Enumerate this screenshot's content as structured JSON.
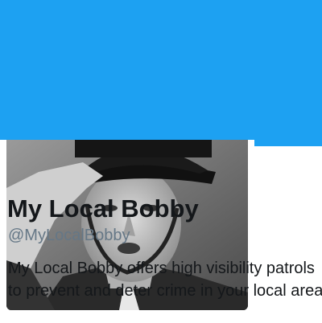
{
  "profile": {
    "display_name": "My Local Bobby",
    "handle": "@MyLocalBobby",
    "bio": "My Local Bobby offers high visibility patrols to prevent and deter crime in your local area",
    "avatar_description": "avatar-photo"
  },
  "colors": {
    "banner": "#1da1f2",
    "name": "#14171a",
    "handle": "#657786"
  }
}
